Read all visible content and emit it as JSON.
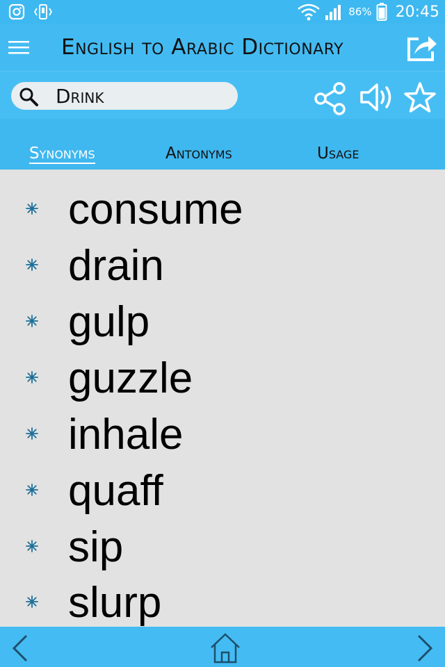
{
  "status_bar": {
    "icons": [
      "instagram-icon",
      "vibrate-icon",
      "wifi-icon",
      "signal-icon",
      "battery-icon"
    ],
    "battery_percent": "86%",
    "time": "20:45"
  },
  "app_bar": {
    "title": "English to Arabic Dictionary",
    "menu_icon": "hamburger-menu-icon",
    "share_out_icon": "share-out-icon"
  },
  "search": {
    "value": "Drink",
    "actions": [
      "share-icon",
      "volume-icon",
      "star-icon"
    ]
  },
  "tabs": [
    {
      "label": "Synonyms",
      "active": true
    },
    {
      "label": "Antonyms",
      "active": false
    },
    {
      "label": "Usage",
      "active": false
    }
  ],
  "words": [
    "consume",
    "drain",
    "gulp",
    "guzzle",
    "inhale",
    "quaff",
    "sip",
    "slurp"
  ],
  "bottom_nav": {
    "icons": [
      "chevron-left-icon",
      "home-icon",
      "chevron-right-icon"
    ]
  },
  "colors": {
    "bar_blue": "#43bbf2",
    "list_background": "#e2e2e2",
    "bullet_blue": "#1a6f99"
  }
}
